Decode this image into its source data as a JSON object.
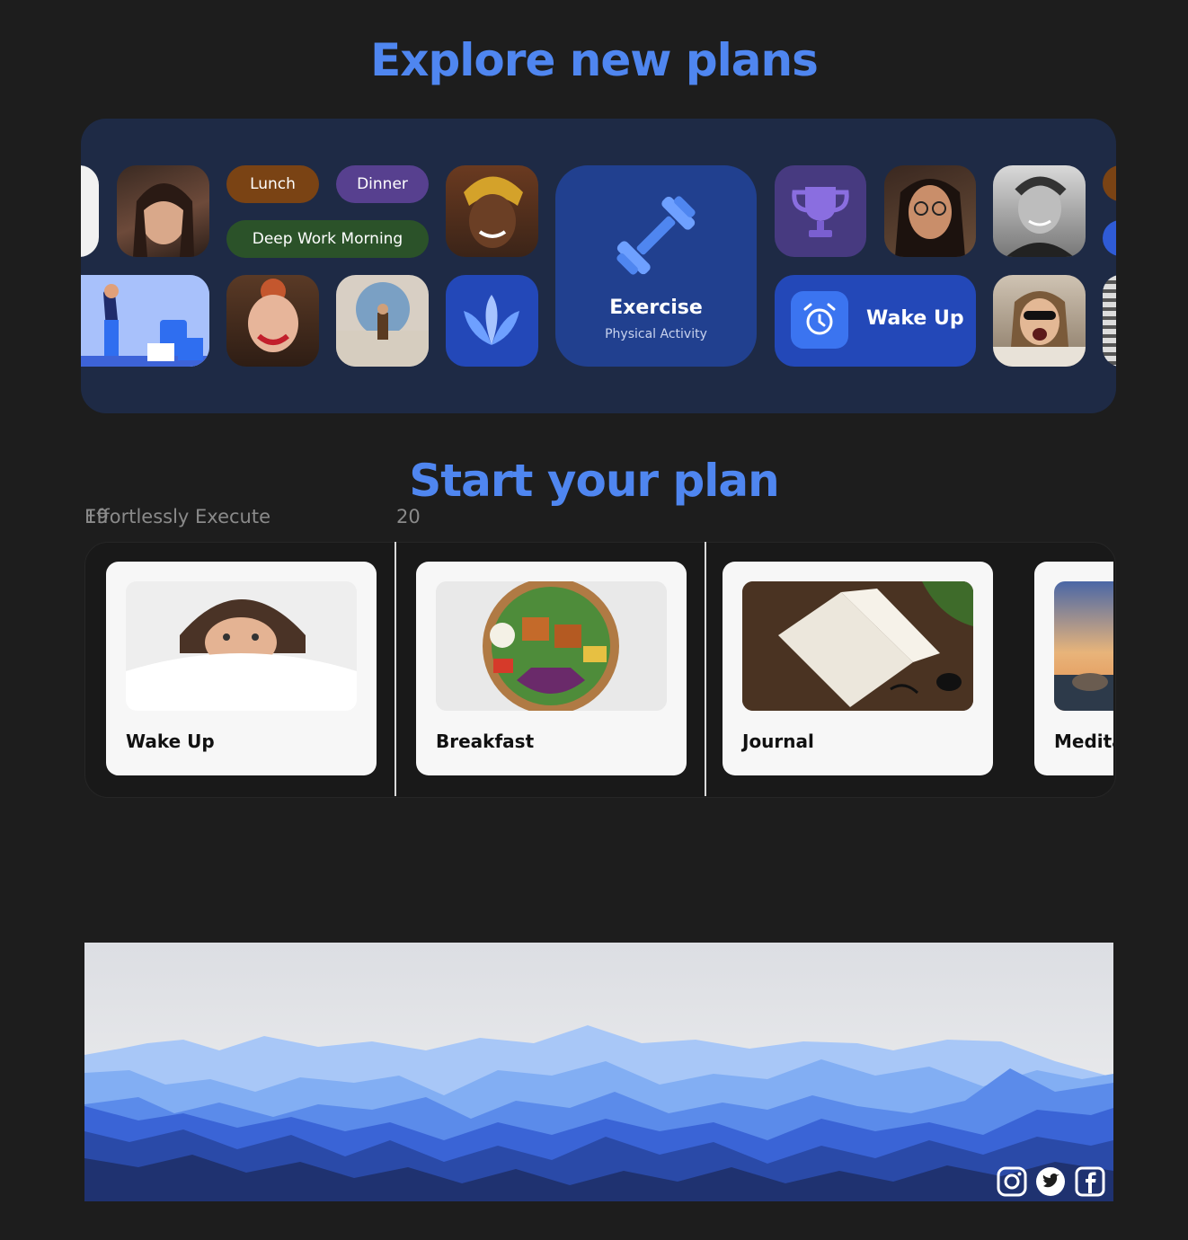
{
  "explore": {
    "title": "Explore new plans",
    "pills": [
      "Lunch",
      "Dinner",
      "Deep Work Morning"
    ],
    "featured": {
      "title": "Exercise",
      "subtitle": "Physical Activity"
    },
    "wake_up_label": "Wake Up",
    "colors": {
      "lunch": "#7a4314",
      "dinner": "#57408f",
      "deep_work": "#2b5229",
      "accent": "#2f6ef0"
    }
  },
  "plans": {
    "title": "Start your plan",
    "subtitle_overlap": "19",
    "subtitle": "Effortlessly Execute",
    "day_number": "20",
    "cards": [
      {
        "label": "Wake Up"
      },
      {
        "label": "Breakfast"
      },
      {
        "label": "Journal"
      },
      {
        "label": "Medita"
      }
    ]
  },
  "footer": {
    "social": [
      "instagram-icon",
      "twitter-icon",
      "facebook-icon"
    ]
  }
}
